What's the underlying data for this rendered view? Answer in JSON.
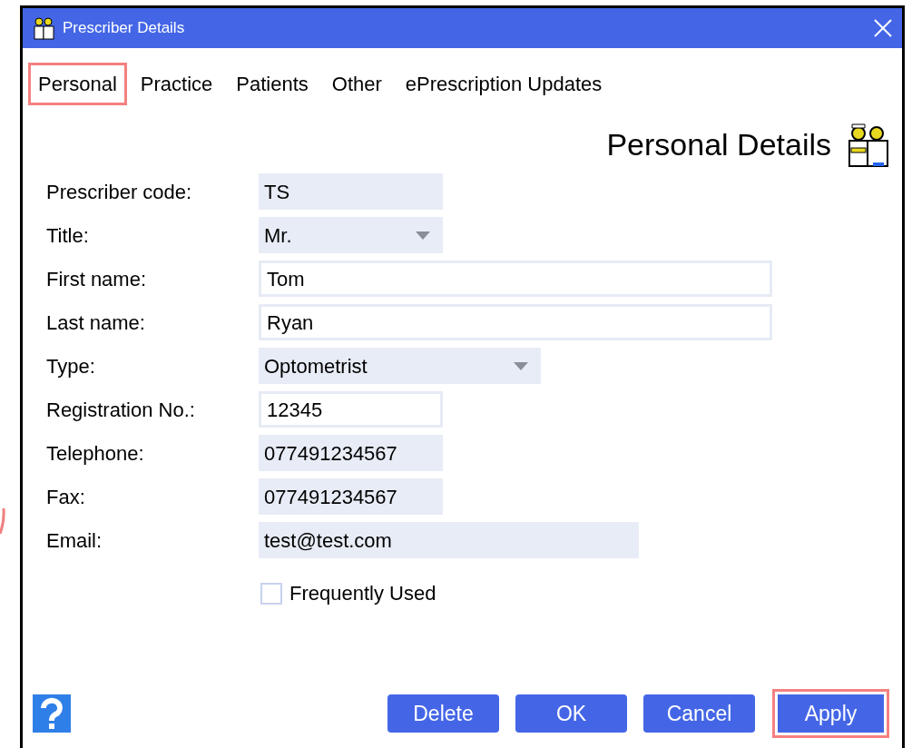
{
  "window": {
    "title": "Prescriber Details"
  },
  "tabs": [
    {
      "label": "Personal",
      "highlighted": true
    },
    {
      "label": "Practice",
      "highlighted": false
    },
    {
      "label": "Patients",
      "highlighted": false
    },
    {
      "label": "Other",
      "highlighted": false
    },
    {
      "label": "ePrescription Updates",
      "highlighted": false
    }
  ],
  "heading": "Personal Details",
  "fields": [
    {
      "label": "Prescriber code:",
      "value": "TS",
      "kind": "text",
      "editable": false
    },
    {
      "label": "Title:",
      "value": "Mr.",
      "kind": "dropdown",
      "editable": false
    },
    {
      "label": "First name:",
      "value": "Tom",
      "kind": "text",
      "editable": true
    },
    {
      "label": "Last name:",
      "value": "Ryan",
      "kind": "text",
      "editable": true
    },
    {
      "label": "Type:",
      "value": "Optometrist",
      "kind": "dropdown",
      "editable": false
    },
    {
      "label": "Registration No.:",
      "value": "12345",
      "kind": "text",
      "editable": true
    },
    {
      "label": "Telephone:",
      "value": "077491234567",
      "kind": "text",
      "editable": false
    },
    {
      "label": "Fax:",
      "value": "077491234567",
      "kind": "text",
      "editable": false
    },
    {
      "label": "Email:",
      "value": "test@test.com",
      "kind": "text",
      "editable": false
    }
  ],
  "frequently_used": {
    "label": "Frequently Used",
    "checked": false
  },
  "buttons": [
    {
      "label": "Delete",
      "highlighted": false
    },
    {
      "label": "OK",
      "highlighted": false
    },
    {
      "label": "Cancel",
      "highlighted": false
    },
    {
      "label": "Apply",
      "highlighted": true
    }
  ]
}
